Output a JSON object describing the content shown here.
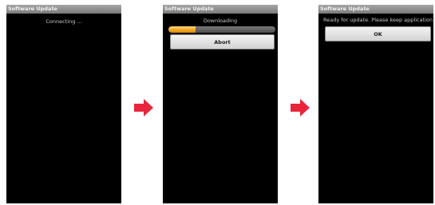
{
  "screens": [
    {
      "title": "Software Update",
      "status": "Connecting ..."
    },
    {
      "title": "Software Update",
      "status": "Downloading",
      "progress": 0.25,
      "button_label": "Abort"
    },
    {
      "title": "Software Update",
      "status": "Ready for update. Please keep application clear.",
      "button_label": "OK"
    }
  ],
  "colors": {
    "arrow": "#e8253a",
    "progress": "#f0a21e",
    "screen_bg": "#000000"
  },
  "icons": {
    "arrow": "right-arrow-icon"
  }
}
